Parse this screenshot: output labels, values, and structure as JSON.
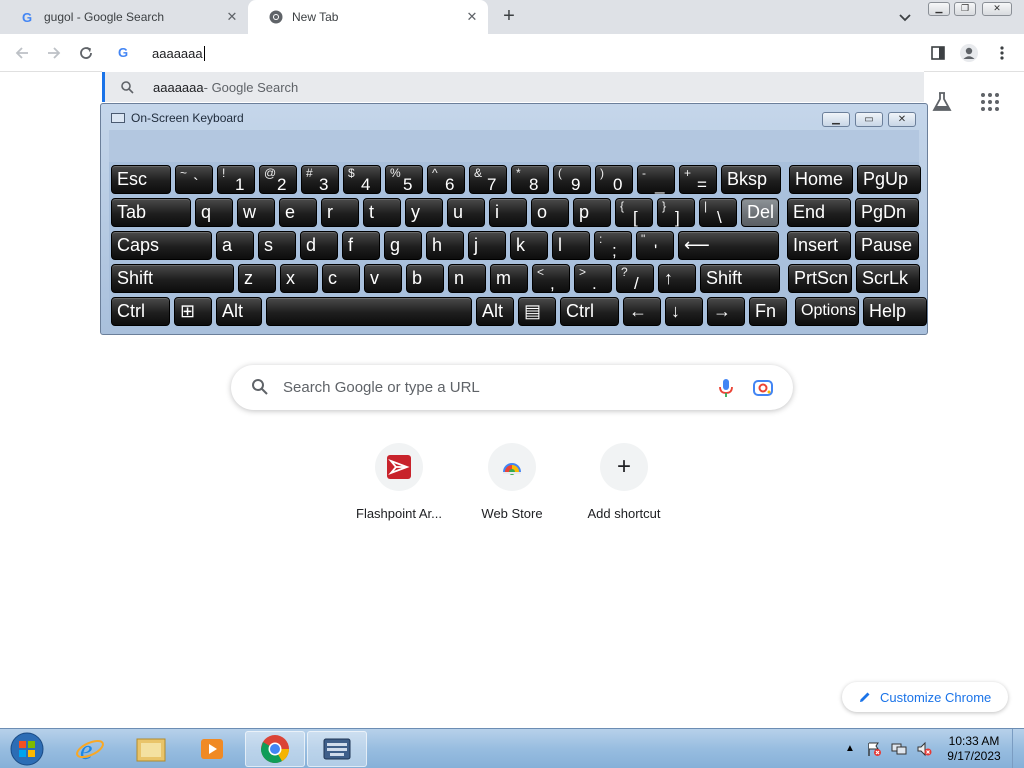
{
  "browser": {
    "tabs": [
      {
        "title": "gugol - Google Search",
        "active": false
      },
      {
        "title": "New Tab",
        "active": true
      }
    ],
    "new_tab_symbol": "+",
    "address_value": "aaaaaaa",
    "suggestion": {
      "query": "aaaaaaa",
      "suffix": " - Google Search"
    }
  },
  "osk": {
    "title": "On-Screen Keyboard",
    "rows": [
      [
        {
          "label": "Esc"
        },
        {
          "top": "~",
          "bot": "`"
        },
        {
          "top": "!",
          "bot": "1"
        },
        {
          "top": "@",
          "bot": "2"
        },
        {
          "top": "#",
          "bot": "3"
        },
        {
          "top": "$",
          "bot": "4"
        },
        {
          "top": "%",
          "bot": "5"
        },
        {
          "top": "^",
          "bot": "6"
        },
        {
          "top": "&",
          "bot": "7"
        },
        {
          "top": "*",
          "bot": "8"
        },
        {
          "top": "(",
          "bot": "9"
        },
        {
          "top": ")",
          "bot": "0"
        },
        {
          "top": "-",
          "bot": "_"
        },
        {
          "top": "+",
          "bot": "="
        },
        {
          "label": "Bksp"
        },
        {
          "label": "Home"
        },
        {
          "label": "PgUp"
        }
      ],
      [
        {
          "label": "Tab"
        },
        {
          "label": "q"
        },
        {
          "label": "w"
        },
        {
          "label": "e"
        },
        {
          "label": "r"
        },
        {
          "label": "t"
        },
        {
          "label": "y"
        },
        {
          "label": "u"
        },
        {
          "label": "i"
        },
        {
          "label": "o"
        },
        {
          "label": "p"
        },
        {
          "top": "{",
          "bot": "["
        },
        {
          "top": "}",
          "bot": "]"
        },
        {
          "top": "|",
          "bot": "\\"
        },
        {
          "label": "Del"
        },
        {
          "label": "End"
        },
        {
          "label": "PgDn"
        }
      ],
      [
        {
          "label": "Caps"
        },
        {
          "label": "a"
        },
        {
          "label": "s"
        },
        {
          "label": "d"
        },
        {
          "label": "f"
        },
        {
          "label": "g"
        },
        {
          "label": "h"
        },
        {
          "label": "j"
        },
        {
          "label": "k"
        },
        {
          "label": "l"
        },
        {
          "top": ":",
          "bot": ";"
        },
        {
          "top": "\"",
          "bot": "'"
        },
        {
          "label": "⟵"
        },
        {
          "label": "Insert"
        },
        {
          "label": "Pause"
        }
      ],
      [
        {
          "label": "Shift"
        },
        {
          "label": "z"
        },
        {
          "label": "x"
        },
        {
          "label": "c"
        },
        {
          "label": "v"
        },
        {
          "label": "b"
        },
        {
          "label": "n"
        },
        {
          "label": "m"
        },
        {
          "top": "<",
          "bot": ","
        },
        {
          "top": ">",
          "bot": "."
        },
        {
          "top": "?",
          "bot": "/"
        },
        {
          "label": "↑"
        },
        {
          "label": "Shift"
        },
        {
          "label": "PrtScn"
        },
        {
          "label": "ScrLk"
        }
      ],
      [
        {
          "label": "Ctrl"
        },
        {
          "label": "⊞"
        },
        {
          "label": "Alt"
        },
        {
          "label": ""
        },
        {
          "label": "Alt"
        },
        {
          "label": "▤"
        },
        {
          "label": "Ctrl"
        },
        {
          "label": "←"
        },
        {
          "label": "↓"
        },
        {
          "label": "→"
        },
        {
          "label": "Fn"
        },
        {
          "label": "Options"
        },
        {
          "label": "Help"
        }
      ]
    ]
  },
  "ntp": {
    "search_placeholder": "Search Google or type a URL",
    "shortcuts": [
      {
        "label": "Flashpoint Ar..."
      },
      {
        "label": "Web Store"
      },
      {
        "label": "Add shortcut"
      }
    ],
    "add_symbol": "+",
    "customize_label": "Customize Chrome"
  },
  "taskbar": {
    "time": "10:33 AM",
    "date": "9/17/2023"
  },
  "colors": {
    "accent": "#1a73e8",
    "key_face": "#1e1e1e",
    "osk_frame": "#a9c0dc"
  }
}
